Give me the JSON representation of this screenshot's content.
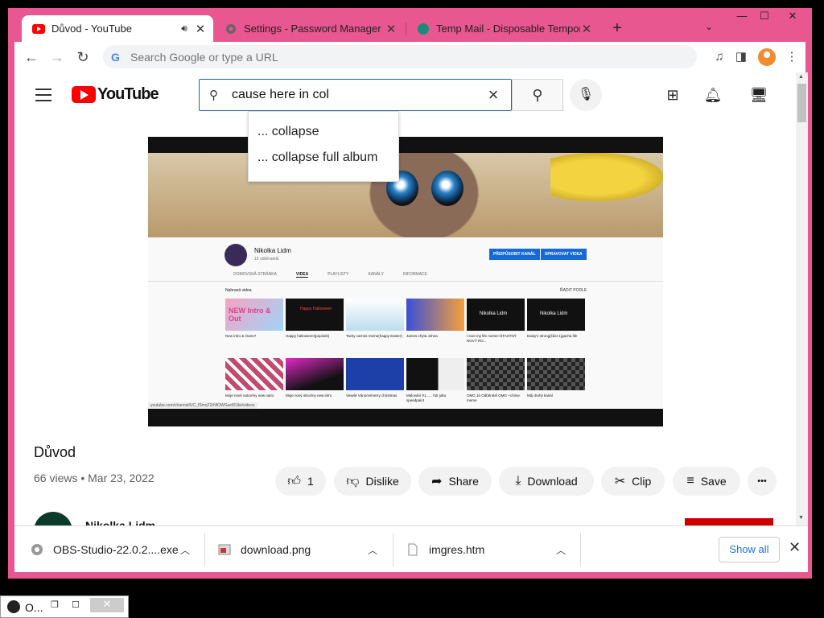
{
  "browser": {
    "tabs": [
      {
        "title": "Důvod - YouTube",
        "active": true
      },
      {
        "title": "Settings - Password Manager",
        "active": false
      },
      {
        "title": "Temp Mail - Disposable Tempora",
        "active": false
      }
    ],
    "new_tab": "+",
    "omnibox_placeholder": "Search Google or type a URL",
    "window_controls": {
      "minimize": "—",
      "maximize": "☐",
      "close": "✕"
    }
  },
  "youtube": {
    "logo_text": "YouTube",
    "search_value": "cause here in col",
    "suggestions": [
      "... collapse",
      "... collapse full album"
    ],
    "video": {
      "title": "Důvod",
      "meta": "66 views • Mar 23, 2022",
      "like_count": "1",
      "dislike_label": "Dislike",
      "share_label": "Share",
      "download_label": "Download",
      "clip_label": "Clip",
      "save_label": "Save",
      "more_label": "•••"
    },
    "channel_name": "Nikolka Lidm",
    "embedded_channel": {
      "name": "Nikolka Lidm",
      "subs": "15 odběratelů",
      "btn_customize": "PŘIZPŮSOBIT KANÁL",
      "btn_manage": "SPRAVOVAT VIDEA",
      "tabs": [
        "DOMOVSKÁ STRÁNKA",
        "VIDEA",
        "PLAYLISTY",
        "KANÁLY",
        "INFORMACE"
      ],
      "section_label": "Nahraná videa",
      "sort_label": "ŘADIT PODLE",
      "url": "youtube.com/channel/UC_fSmqT2rNfOWGwdXUlw/videos",
      "row1_captions": [
        "New intro & Outro?",
        "Happy halloween!(popisek)",
        "Tacky carrots meme(happy Easter)",
        "James chyta Johna",
        "I love my life meme+ŠTASTNÝ NOVÝ RO...",
        "Daisy's strong(část 1)gacha life"
      ],
      "row2_captions": [
        "Moje nové outro/my new outro",
        "Moje nový intro/my new intro",
        "Veselé Vánoce/merry christmas",
        "Malování #1...... fotr jako speedpaint",
        "OMG 10 Odběratel OMG +chime meme",
        "Můj druhý kanál"
      ],
      "thumb_text": [
        "NEW Intro & Out",
        "Happy Halloween",
        "Nikolka Lidm",
        "Nikolka Lidm"
      ]
    }
  },
  "downloads": {
    "items": [
      "OBS-Studio-22.0.2....exe",
      "download.png",
      "imgres.htm"
    ],
    "show_all": "Show all"
  },
  "taskbar": {
    "label": "O..."
  },
  "colors": {
    "frame": "#e8578f",
    "yt_red": "#ff0000",
    "accent_blue": "#1a73e8"
  }
}
